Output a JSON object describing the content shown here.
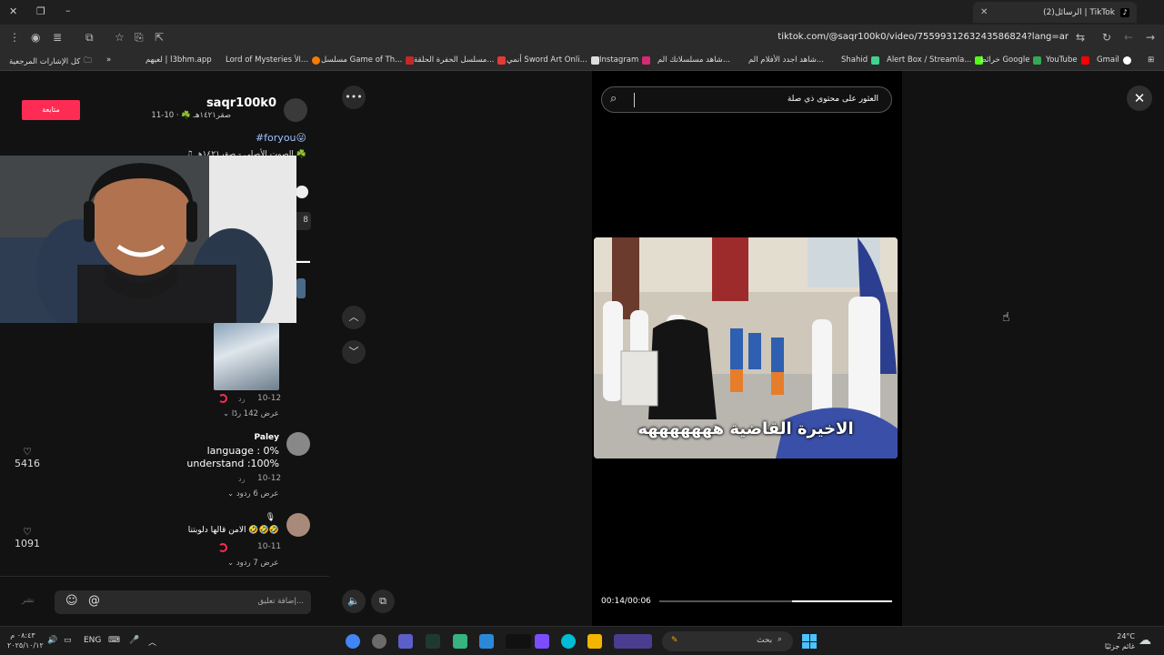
{
  "browser": {
    "tab_title": "(2)الرسائل | TikTok",
    "tab_icon": "tiktok-icon",
    "url": "tiktok.com/@saqr100k0/video/7559931263243586824?lang=ar",
    "bookmarks": [
      {
        "label": "Gmail",
        "color": "#ea4335"
      },
      {
        "label": "YouTube",
        "color": "#ff0000"
      },
      {
        "label": "خرائط Google",
        "color": "#34a853"
      },
      {
        "label": "Alert Box / Streamla...",
        "color": "#53fc18"
      },
      {
        "label": "Shahid",
        "color": "#3fd38e"
      },
      {
        "label": "شاهد اجدد الأفلام الم...",
        "color": "#444444"
      },
      {
        "label": "شاهد مسلسلاتك الم...",
        "color": "#555555"
      },
      {
        "label": "Instagram",
        "color": "#d62976"
      },
      {
        "label": "أنمي Sword Art Onli...",
        "color": "#666666"
      },
      {
        "label": "مسلسل الحفرة الحلقة...",
        "color": "#e53935"
      },
      {
        "label": "مسلسل Game of Th...",
        "color": "#c62828"
      },
      {
        "label": "Lord of Mysteries الأ...",
        "color": "#f57c00"
      },
      {
        "label": "لعيهم | l3bhm.app",
        "color": "#333333"
      },
      {
        "label": "كل الإشارات المرجعية",
        "color": "#777777"
      }
    ]
  },
  "profile": {
    "follow_label": "متابعة",
    "username": "saqr100k0",
    "meta": "صقر١٤٢١هـ ☘️ · 10-11",
    "hashtag": "#foryou😜",
    "music": "♫ الصوت الأصلي - صقر١٤٢١هـ ☘️",
    "like_count_partial": "8"
  },
  "comments": [
    {
      "date": "10-12",
      "reply": "رد",
      "view_replies": "عرض 142 ردًا"
    },
    {
      "author": "Paley",
      "line1": "language : 0%",
      "line2": "understand :100%",
      "date": "10-12",
      "reply": "رد",
      "view_replies": "عرض 6 ردود",
      "likes": "5416"
    },
    {
      "author": "🎙",
      "text": "الامن قالها دلوبتنا 🤣🤣🤣",
      "date": "10-11",
      "reply": "رد",
      "view_replies": "عرض 7 ردود",
      "likes": "1091"
    }
  ],
  "comment_bar": {
    "placeholder": "إضافة تعليق...",
    "post_label": "نشر"
  },
  "video": {
    "search_placeholder": "العثور على محتوى ذي صلة",
    "caption": "الاخيرة القاضية هههههههه",
    "time": "00:14/00:06",
    "progress": 0.57
  },
  "taskbar": {
    "search_label": "بحث",
    "lang": "ENG",
    "time": "٠٨:٤٣ م",
    "date": "٢٠٢٥/١٠/١٢",
    "weather_temp": "24°C",
    "weather_desc": "غائم جزئيًا"
  }
}
